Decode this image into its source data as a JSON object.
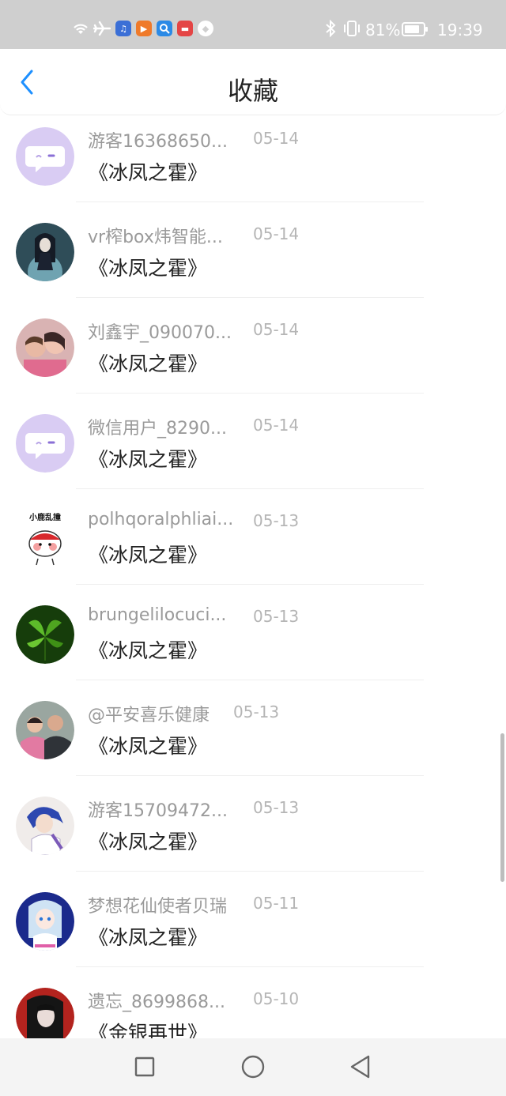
{
  "status_bar": {
    "battery_text": "81%",
    "battery_level": 0.81,
    "time": "19:39",
    "icons": [
      "wifi-icon",
      "airplane-icon",
      "music-app-icon",
      "video-app-icon",
      "search-app-icon",
      "shop-app-icon",
      "ball-app-icon",
      "bluetooth-icon",
      "vibrate-icon"
    ]
  },
  "header": {
    "title": "收藏",
    "back_icon": "chevron-left-icon",
    "accent_color": "#1e90ff"
  },
  "items": [
    {
      "name": "游客16368650...",
      "date": "05-14",
      "book": "《冰凤之霍》",
      "avatar": "default-purple"
    },
    {
      "name": "vr榨box炜智能...",
      "date": "05-14",
      "book": "《冰凤之霍》",
      "avatar": "anime-girl-dark"
    },
    {
      "name": "刘鑫宇_090070...",
      "date": "05-14",
      "book": "《冰凤之霍》",
      "avatar": "photo-pink"
    },
    {
      "name": "微信用户_8290...",
      "date": "05-14",
      "book": "《冰凤之霍》",
      "avatar": "default-purple"
    },
    {
      "name": "polhqoralphliai...",
      "date": "05-13",
      "book": "《冰凤之霍》",
      "avatar": "sticker-deer"
    },
    {
      "name": "brungelilocuci...",
      "date": "05-13",
      "book": "《冰凤之霍》",
      "avatar": "green-leaf"
    },
    {
      "name": "@平安喜乐健康",
      "date": "05-13",
      "book": "《冰凤之霍》",
      "avatar": "photo-couple"
    },
    {
      "name": "游客15709472...",
      "date": "05-13",
      "book": "《冰凤之霍》",
      "avatar": "anime-boy-blue"
    },
    {
      "name": "梦想花仙使者贝瑞",
      "date": "05-11",
      "book": "《冰凤之霍》",
      "avatar": "anime-girl-white"
    },
    {
      "name": "遗忘_8699868...",
      "date": "05-10",
      "book": "《金银再世》",
      "avatar": "anime-red-dark"
    }
  ],
  "avatar_sticker_text": "小鹿乱撞",
  "bottom_nav": {
    "icons": [
      "recent-apps-icon",
      "home-icon",
      "back-icon"
    ]
  }
}
